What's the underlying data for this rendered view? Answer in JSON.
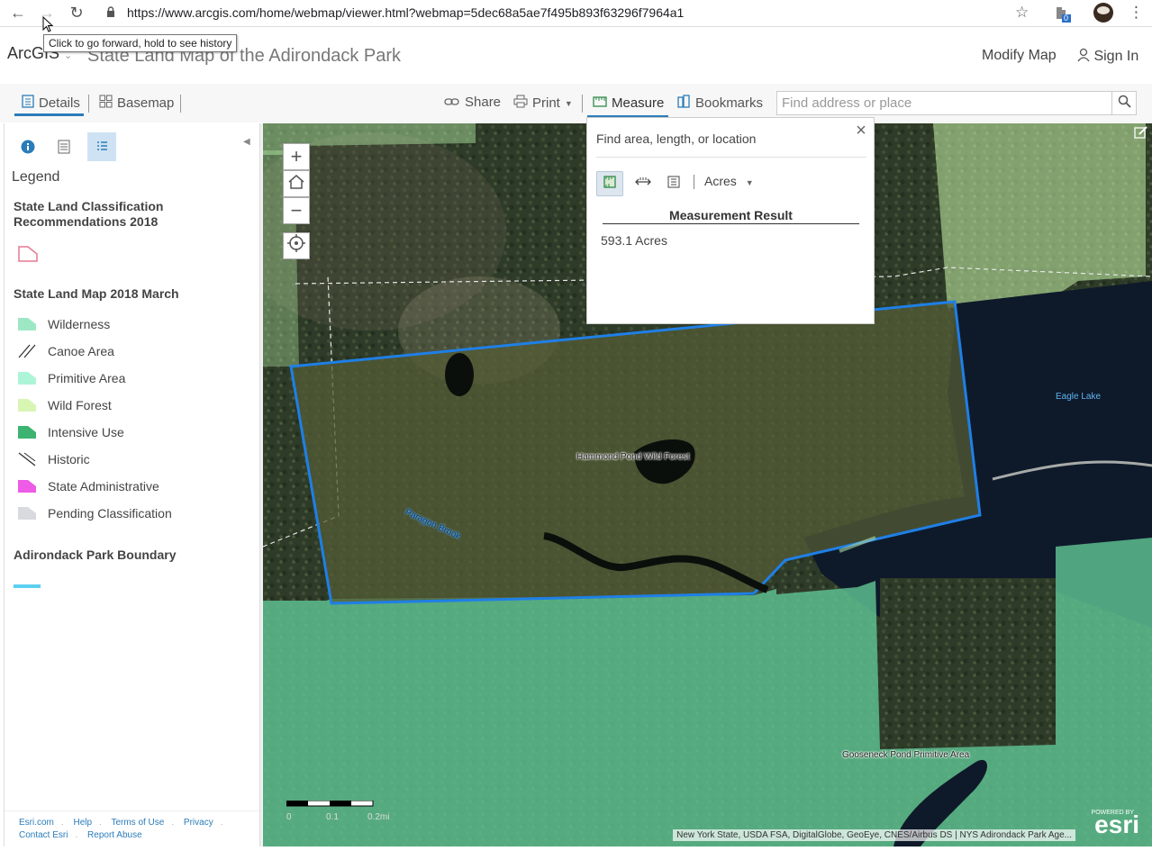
{
  "browser": {
    "url": "https://www.arcgis.com/home/webmap/viewer.html?webmap=5dec68a5ae7f495b893f63296f7964a1",
    "tooltip": "Click to go forward, hold to see history",
    "extension_badge": "0"
  },
  "header": {
    "logo": "ArcGIS",
    "title": "State Land Map of the Adirondack Park",
    "modify_map": "Modify Map",
    "sign_in": "Sign In"
  },
  "toolbar": {
    "details": "Details",
    "basemap": "Basemap",
    "share": "Share",
    "print": "Print",
    "measure": "Measure",
    "bookmarks": "Bookmarks",
    "search_placeholder": "Find address or place"
  },
  "panel": {
    "legend_title": "Legend",
    "layers": [
      {
        "title": "State Land Classification Recommendations 2018"
      },
      {
        "title": "State Land Map 2018 March",
        "items": [
          {
            "label": "Wilderness",
            "color": "#9de8c4"
          },
          {
            "label": "Canoe Area",
            "color": "hatch"
          },
          {
            "label": "Primitive Area",
            "color": "#aef5d8"
          },
          {
            "label": "Wild Forest",
            "color": "#d7f6b4"
          },
          {
            "label": "Intensive Use",
            "color": "#3cb371"
          },
          {
            "label": "Historic",
            "color": "hatch2"
          },
          {
            "label": "State Administrative",
            "color": "#ee5be6"
          },
          {
            "label": "Pending Classification",
            "color": "#d9dadf"
          }
        ]
      },
      {
        "title": "Adirondack Park Boundary"
      }
    ],
    "footer": {
      "links": [
        "Esri.com",
        "Help",
        "Terms of Use",
        "Privacy",
        "Contact Esri",
        "Report Abuse"
      ]
    }
  },
  "map": {
    "labels": {
      "hammond": "Hammond Pond Wild Forest",
      "eagle": "Eagle Lake",
      "paragon": "Paragon Brook",
      "gooseneck": "Gooseneck Pond Primitive Area"
    },
    "scale": {
      "t0": "0",
      "t1": "0.1",
      "t2": "0.2mi"
    },
    "attribution": "New York State, USDA FSA, DigitalGlobe, GeoEye, CNES/Airbus DS | NYS Adirondack Park Age...",
    "esri_powered": "POWERED BY",
    "esri_logo": "esri"
  },
  "measure": {
    "hint": "Find area, length, or location",
    "unit": "Acres",
    "result_header": "Measurement Result",
    "result_value": "593.1 Acres"
  }
}
